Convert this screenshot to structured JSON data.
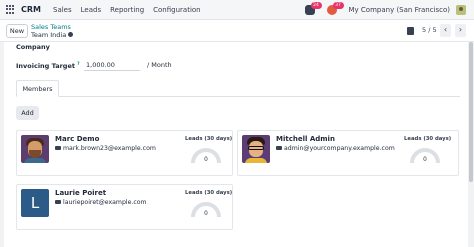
{
  "app": {
    "name": "CRM"
  },
  "menu": [
    "Sales",
    "Leads",
    "Reporting",
    "Configuration"
  ],
  "systray": {
    "messages_count": "24",
    "activities_count": "37",
    "company": "My Company (San Francisco)"
  },
  "control": {
    "new_label": "New",
    "breadcrumb_parent": "Sales Teams",
    "breadcrumb_current": "Team India",
    "pager": "5 / 5",
    "prev_icon": "‹",
    "next_icon": "›"
  },
  "form": {
    "company_label": "Company",
    "target_label": "Invoicing Target",
    "target_help": "?",
    "target_value": "1,000.00",
    "target_unit": "/ Month"
  },
  "tabs": [
    {
      "label": "Members"
    }
  ],
  "add_label": "Add",
  "members": [
    {
      "name": "Marc Demo",
      "email": "mark.brown23@example.com",
      "leads_label": "Leads (30 days)",
      "leads_value": "0",
      "gauge_fraction": 0
    },
    {
      "name": "Mitchell Admin",
      "email": "admin@yourcompany.example.com",
      "leads_label": "Leads (30 days)",
      "leads_value": "0",
      "gauge_fraction": 0
    },
    {
      "name": "Laurie Poiret",
      "email": "lauriepoiret@example.com",
      "leads_label": "Leads (30 days)",
      "leads_value": "0",
      "gauge_fraction": 0,
      "initial": "L"
    }
  ],
  "colors": {
    "brand": "#714b67",
    "link": "#017e84",
    "badge": "#e6336a",
    "activities": "#e45a41"
  }
}
